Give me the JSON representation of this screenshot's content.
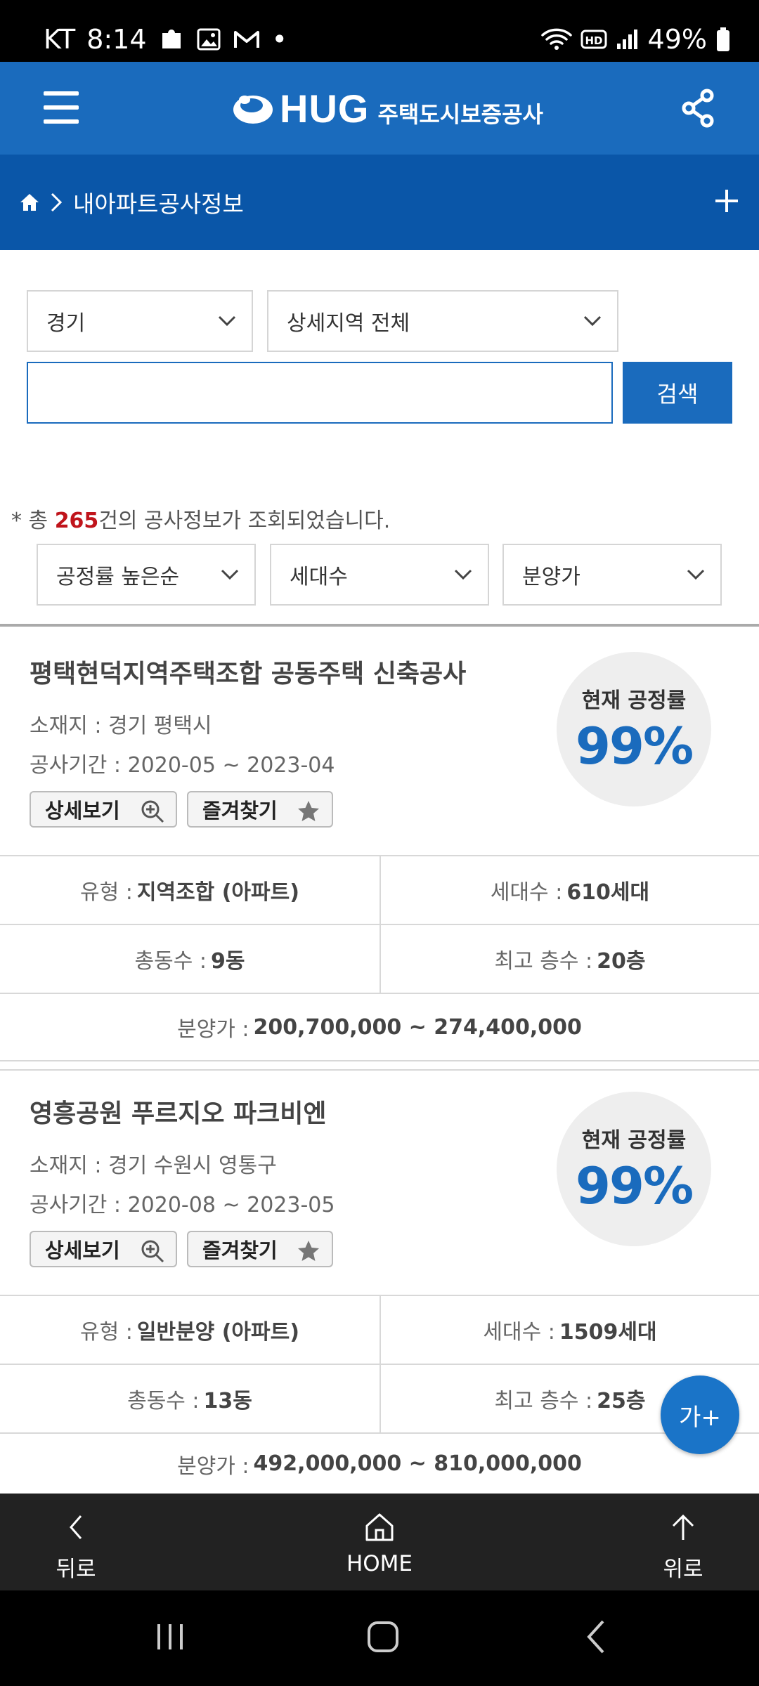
{
  "status_bar": {
    "carrier": "KT",
    "time": "8:14",
    "dot": "•",
    "battery": "49%"
  },
  "header": {
    "logo_text": "HUG",
    "logo_kor": "주택도시보증공사"
  },
  "breadcrumb": {
    "title": "내아파트공사정보"
  },
  "filters": {
    "region": "경기",
    "subregion": "상세지역 전체",
    "search_placeholder": "",
    "search_button": "검색"
  },
  "result": {
    "prefix": "* 총 ",
    "count": "265",
    "suffix": "건의 공사정보가 조회되었습니다."
  },
  "sort": {
    "order": "공정률 높은순",
    "households": "세대수",
    "price": "분양가"
  },
  "cards": [
    {
      "title": "평택현덕지역주택조합 공동주택 신축공사",
      "location": "소재지 : 경기 평택시",
      "period": "공사기간 : 2020-05 ~ 2023-04",
      "detail_label": "상세보기",
      "favorite_label": "즐겨찾기",
      "gauge_label": "현재 공정률",
      "progress": "99%",
      "type_label": "유형 :",
      "type_value": "지역조합 (아파트)",
      "households_label": "세대수 :",
      "households_value": "610세대",
      "buildings_label": "총동수 :",
      "buildings_value": "9동",
      "floors_label": "최고 층수 :",
      "floors_value": "20층",
      "price_label": "분양가 :",
      "price_value": "200,700,000 ~ 274,400,000"
    },
    {
      "title": "영흥공원 푸르지오 파크비엔",
      "location": "소재지 : 경기 수원시 영통구",
      "period": "공사기간 : 2020-08 ~ 2023-05",
      "detail_label": "상세보기",
      "favorite_label": "즐겨찾기",
      "gauge_label": "현재 공정률",
      "progress": "99%",
      "type_label": "유형 :",
      "type_value": "일반분양 (아파트)",
      "households_label": "세대수 :",
      "households_value": "1509세대",
      "buildings_label": "총동수 :",
      "buildings_value": "13동",
      "floors_label": "최고 층수 :",
      "floors_value": "25층",
      "price_label": "분양가 :",
      "price_value": "492,000,000 ~ 810,000,000"
    }
  ],
  "fab": {
    "label": "가+"
  },
  "bottom_nav": {
    "back": "뒤로",
    "home": "HOME",
    "top": "위로"
  },
  "colors": {
    "brand_blue": "#1a6bbd",
    "breadcrumb_blue": "#0a56a8",
    "count_red": "#c0141b"
  }
}
